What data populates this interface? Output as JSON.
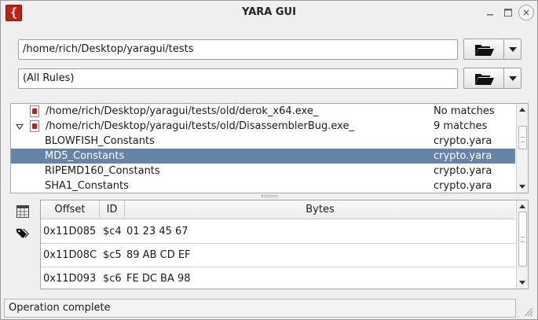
{
  "window": {
    "title": "YARA GUI",
    "app_icon_glyph": "{"
  },
  "controls": {
    "path_value": "/home/rich/Desktop/yaragui/tests",
    "rules_value": "(All Rules)"
  },
  "results": [
    {
      "type": "file",
      "expanded": false,
      "name": "/home/rich/Desktop/yaragui/tests/old/derok_x64.exe_",
      "status": "No matches"
    },
    {
      "type": "file",
      "expanded": true,
      "name": "/home/rich/Desktop/yaragui/tests/old/DisassemblerBug.exe_",
      "status": "9 matches"
    },
    {
      "type": "rule",
      "name": "BLOWFISH_Constants",
      "file": "crypto.yara",
      "selected": false
    },
    {
      "type": "rule",
      "name": "MD5_Constants",
      "file": "crypto.yara",
      "selected": true
    },
    {
      "type": "rule",
      "name": "RIPEMD160_Constants",
      "file": "crypto.yara",
      "selected": false
    },
    {
      "type": "rule",
      "name": "SHA1_Constants",
      "file": "crypto.yara",
      "selected": false
    }
  ],
  "bytes_table": {
    "columns": [
      "Offset",
      "ID",
      "Bytes"
    ],
    "rows": [
      {
        "offset": "0x11D085",
        "id": "$c4",
        "bytes": "01 23 45 67"
      },
      {
        "offset": "0x11D08C",
        "id": "$c5",
        "bytes": "89 AB CD EF"
      },
      {
        "offset": "0x11D093",
        "id": "$c6",
        "bytes": "FE DC BA 98"
      }
    ]
  },
  "status": {
    "text": "Operation complete"
  },
  "colors": {
    "selection": "#6684a7",
    "app_icon": "#c31f17"
  },
  "icons": {
    "browse": "folder-open-icon",
    "dropdown": "chevron-down-icon",
    "table_view": "table-icon",
    "tags": "tags-icon"
  }
}
